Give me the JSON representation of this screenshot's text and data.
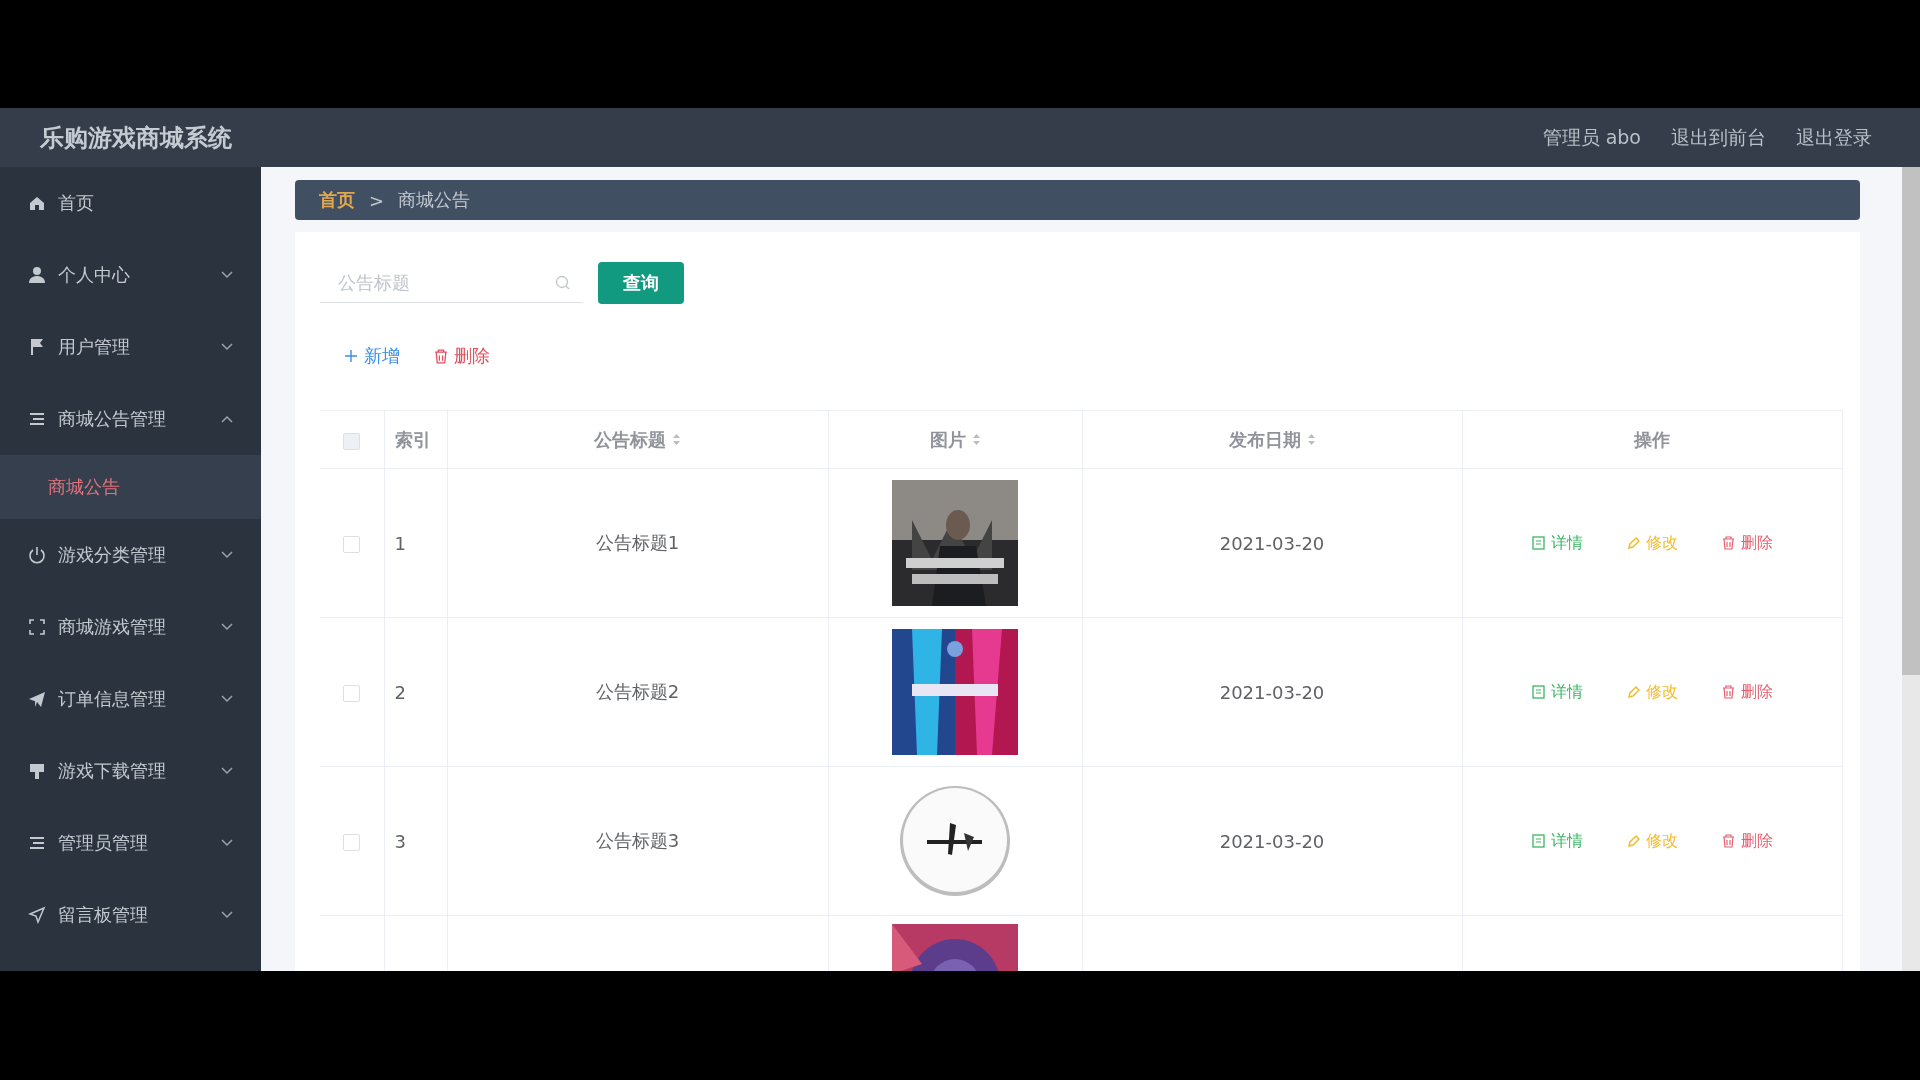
{
  "header": {
    "title": "乐购游戏商城系统",
    "links": [
      "管理员 abo",
      "退出到前台",
      "退出登录"
    ]
  },
  "sidebar": {
    "items": [
      {
        "label": "首页"
      },
      {
        "label": "个人中心",
        "expanded": false
      },
      {
        "label": "用户管理",
        "expanded": false
      },
      {
        "label": "商城公告管理",
        "expanded": true,
        "children": [
          {
            "label": "商城公告",
            "selected": true
          }
        ]
      },
      {
        "label": "游戏分类管理",
        "expanded": false
      },
      {
        "label": "商城游戏管理",
        "expanded": false
      },
      {
        "label": "订单信息管理",
        "expanded": false
      },
      {
        "label": "游戏下载管理",
        "expanded": false
      },
      {
        "label": "管理员管理",
        "expanded": false
      },
      {
        "label": "留言板管理",
        "expanded": false
      }
    ]
  },
  "breadcrumb": {
    "items": [
      "首页",
      "商城公告"
    ],
    "separator": ">"
  },
  "search": {
    "placeholder": "公告标题",
    "button": "查询"
  },
  "actions": [
    {
      "kind": "add",
      "label": "新增"
    },
    {
      "kind": "delete",
      "label": "删除"
    }
  ],
  "table": {
    "select_all": {
      "checked": false
    },
    "columns": [
      {
        "label": "索引",
        "sortable": false
      },
      {
        "label": "公告标题",
        "sortable": true
      },
      {
        "label": "图片",
        "sortable": true
      },
      {
        "label": "发布日期",
        "sortable": true
      },
      {
        "label": "操作",
        "sortable": false
      }
    ],
    "rows": [
      {
        "checked": false,
        "index": "1",
        "title": "公告标题1",
        "image": {
          "kind": "picture"
        },
        "date": "2021-03-20",
        "ops": [
          "详情",
          "修改",
          "删除"
        ]
      },
      {
        "checked": false,
        "index": "2",
        "title": "公告标题2",
        "image": {
          "kind": "picture"
        },
        "date": "2021-03-20",
        "ops": [
          "详情",
          "修改",
          "删除"
        ]
      },
      {
        "checked": false,
        "index": "3",
        "title": "公告标题3",
        "image": {
          "kind": "picture"
        },
        "date": "2021-03-20",
        "ops": [
          "详情",
          "修改",
          "删除"
        ]
      },
      {
        "image": {
          "kind": "picture"
        }
      }
    ]
  }
}
